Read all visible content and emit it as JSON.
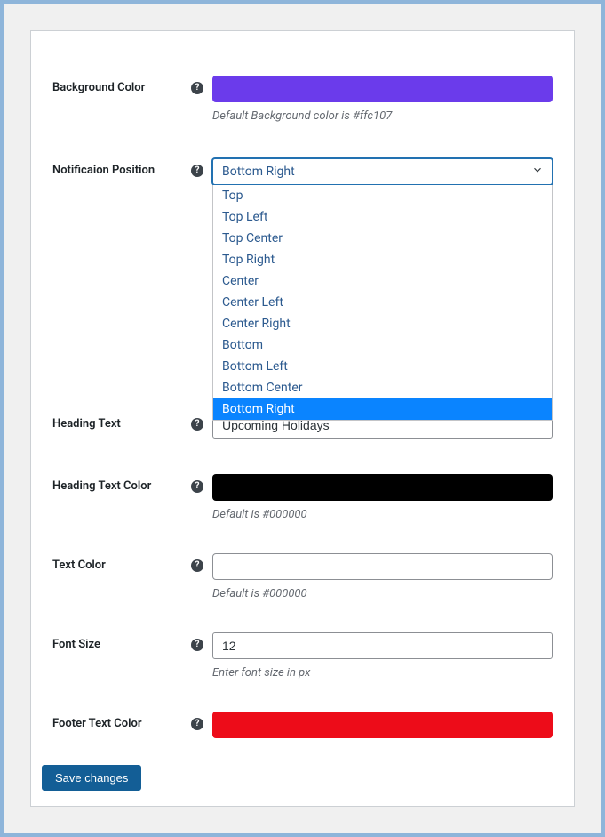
{
  "fields": {
    "background_color": {
      "label": "Background Color",
      "helper": "Default Background color is #ffc107",
      "color": "#6b3beb"
    },
    "notification_position": {
      "label": "Notificaion Position",
      "selected": "Bottom Right",
      "options": [
        "Top",
        "Top Left",
        "Top Center",
        "Top Right",
        "Center",
        "Center Left",
        "Center Right",
        "Bottom",
        "Bottom Left",
        "Bottom Center",
        "Bottom Right"
      ]
    },
    "heading_text": {
      "label": "Heading Text",
      "value": "Upcoming Holidays"
    },
    "heading_text_color": {
      "label": "Heading Text Color",
      "helper": "Default is #000000",
      "color": "#000000"
    },
    "text_color": {
      "label": "Text Color",
      "helper": "Default is #000000",
      "color": "#ffffff"
    },
    "font_size": {
      "label": "Font Size",
      "value": "12",
      "helper": "Enter font size in px"
    },
    "footer_text_color": {
      "label": "Footer Text Color",
      "color": "#ed0c19"
    }
  },
  "buttons": {
    "save": "Save changes"
  }
}
